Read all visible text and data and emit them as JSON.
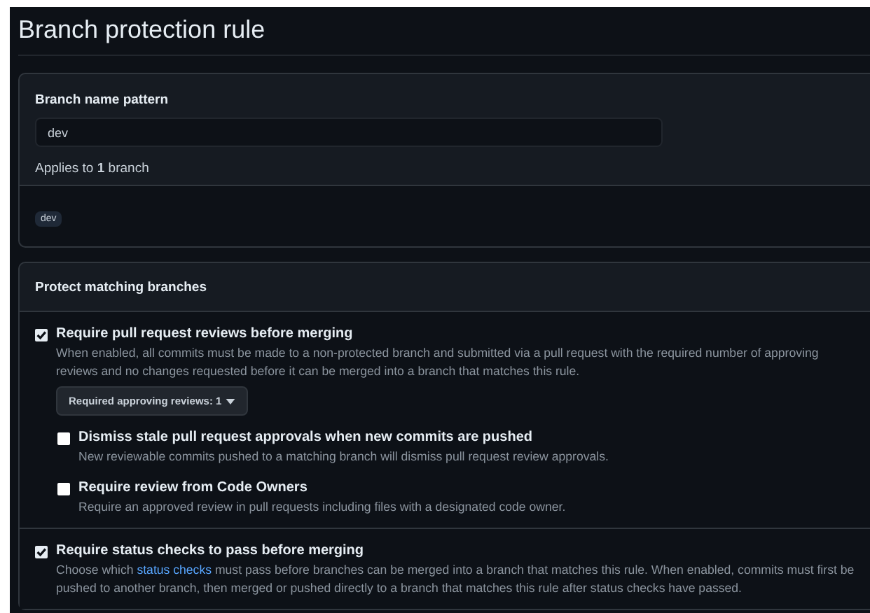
{
  "title": "Branch protection rule",
  "pattern": {
    "label": "Branch name pattern",
    "value": "dev",
    "applies": "Applies to **1** branch",
    "branches": [
      "dev"
    ]
  },
  "protect": {
    "heading": "Protect matching branches",
    "rules": [
      {
        "title": "Require pull request reviews before merging",
        "checked": true,
        "description": [
          {
            "kind": "text",
            "text": "When enabled, all commits must be made to a non-protected branch and submitted via a pull request with the required number of approving reviews and no changes requested before it can be merged into a branch that matches this rule."
          }
        ],
        "select": "Required approving reviews: 1",
        "children": [
          {
            "title": "Dismiss stale pull request approvals when new commits are pushed",
            "checked": false,
            "description": [
              {
                "kind": "text",
                "text": "New reviewable commits pushed to a matching branch will dismiss pull request review approvals."
              }
            ]
          },
          {
            "title": "Require review from Code Owners",
            "checked": false,
            "description": [
              {
                "kind": "text",
                "text": "Require an approved review in pull requests including files with a designated code owner."
              }
            ]
          }
        ]
      },
      {
        "title": "Require status checks to pass before merging",
        "checked": true,
        "description": [
          {
            "kind": "text",
            "text": "Choose which "
          },
          {
            "kind": "link",
            "text": "status checks"
          },
          {
            "kind": "text",
            "text": " must pass before branches can be merged into a branch that matches this rule. When enabled, commits must first be pushed to another branch, then merged or pushed directly to a branch that matches this rule after status checks have passed."
          }
        ]
      }
    ]
  }
}
